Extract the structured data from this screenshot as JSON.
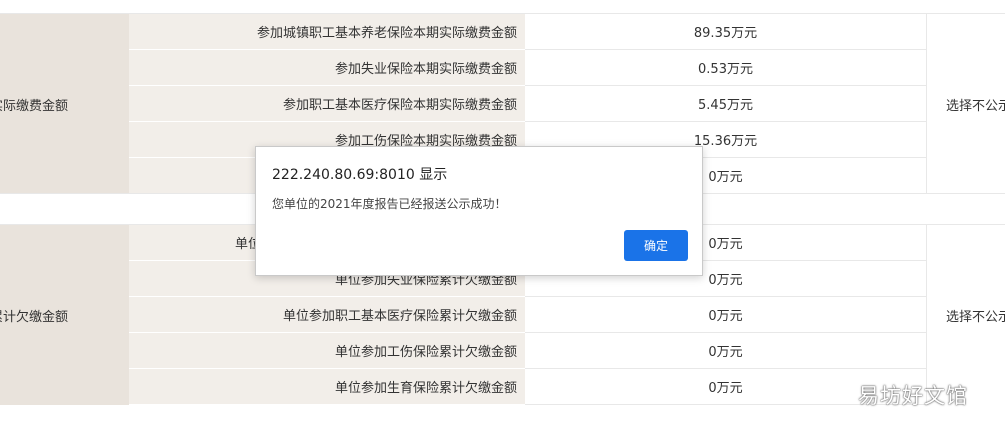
{
  "section_paid": {
    "label": "实际缴费金额",
    "right_text": "选择不公示",
    "rows": [
      {
        "name": "参加城镇职工基本养老保险本期实际缴费金额",
        "value": "89.35万元"
      },
      {
        "name": "参加失业保险本期实际缴费金额",
        "value": "0.53万元"
      },
      {
        "name": "参加职工基本医疗保险本期实际缴费金额",
        "value": "5.45万元"
      },
      {
        "name": "参加工伤保险本期实际缴费金额",
        "value": "15.36万元"
      },
      {
        "name": "",
        "value": "0万元"
      }
    ]
  },
  "section_arrears": {
    "label": "累计欠缴金额",
    "right_text": "选择不公示",
    "rows": [
      {
        "name": "单位",
        "value": "0万元"
      },
      {
        "name": "单位参加失业保险累计欠缴金额",
        "value": "0万元"
      },
      {
        "name": "单位参加职工基本医疗保险累计欠缴金额",
        "value": "0万元"
      },
      {
        "name": "单位参加工伤保险累计欠缴金额",
        "value": "0万元"
      },
      {
        "name": "单位参加生育保险累计欠缴金额",
        "value": "0万元"
      }
    ]
  },
  "dialog": {
    "title": "222.240.80.69:8010 显示",
    "message": "您单位的2021年度报告已经报送公示成功！",
    "ok_label": "确定"
  },
  "watermark": "易坊好文馆"
}
